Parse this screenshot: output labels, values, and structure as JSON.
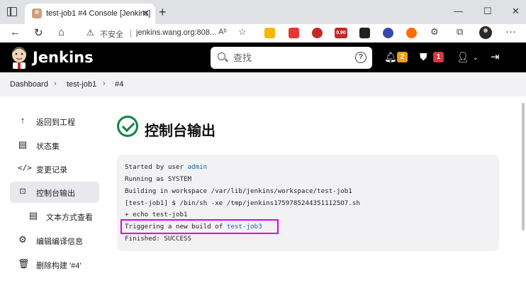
{
  "browser": {
    "tab_title": "test-job1 #4 Console [Jenkins]",
    "tab_close": "✕",
    "new_tab": "+",
    "window_controls": [
      "—",
      "☐",
      "✕"
    ],
    "security_label": "不安全",
    "url": "jenkins.wang.org:808...",
    "read_aloud": "Aᵇ",
    "extension_badge": "0.90",
    "more_menu": "···"
  },
  "jenkins": {
    "brand": "Jenkins",
    "search_placeholder": "查找",
    "notifications_count": "2",
    "security_count": "1"
  },
  "breadcrumb": {
    "items": [
      "Dashboard",
      "test-job1",
      "#4"
    ]
  },
  "sidebar": {
    "items": [
      {
        "label": "返回到工程",
        "icon": "arrow-up-icon"
      },
      {
        "label": "状态集",
        "icon": "document-icon"
      },
      {
        "label": "变更记录",
        "icon": "code-icon"
      },
      {
        "label": "控制台输出",
        "icon": "terminal-icon",
        "active": true
      },
      {
        "label": "文本方式查看",
        "icon": "document-icon"
      },
      {
        "label": "编辑编译信息",
        "icon": "gear-icon"
      },
      {
        "label": "删除构建 '#4'",
        "icon": "trash-icon"
      }
    ]
  },
  "main": {
    "title": "控制台输出",
    "console": {
      "line1_prefix": "Started by user ",
      "line1_user": "admin",
      "line2": "Running as SYSTEM",
      "line3": "Building in workspace /var/lib/jenkins/workspace/test-job1",
      "line4": "[test-job1] $ /bin/sh -xe /tmp/jenkins17597852443511125O7.sh",
      "line5": "+ echo test-job1",
      "line6_prefix": "Triggering a new build of ",
      "line6_job": "test-job3",
      "line7": "Finished: SUCCESS"
    }
  },
  "colors": {
    "success_green": "#138347",
    "highlight_magenta": "#e000e0",
    "link_blue": "#1a5fb4",
    "badge_orange": "#f39c12",
    "badge_red": "#d9363e"
  }
}
